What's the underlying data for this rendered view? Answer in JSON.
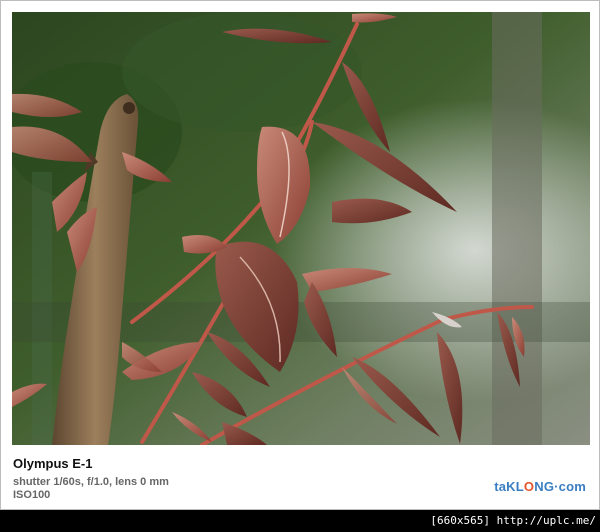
{
  "caption": {
    "camera": "Olympus E-1",
    "exposure": "shutter 1/60s,  f/1.0,  lens 0 mm",
    "iso": "ISO100"
  },
  "logo": {
    "part1": "taKL",
    "part2": "O",
    "part3": "NG·com"
  },
  "watermark": "[660x565] http://uplc.me/",
  "photo": {
    "subject": "reddish young leaves on a branch beside a bare wooden twig",
    "colors": {
      "background_green": "#3f5e2c",
      "leaf": "#a8584a",
      "stem": "#c0584a",
      "twig": "#8b6e4e"
    }
  }
}
